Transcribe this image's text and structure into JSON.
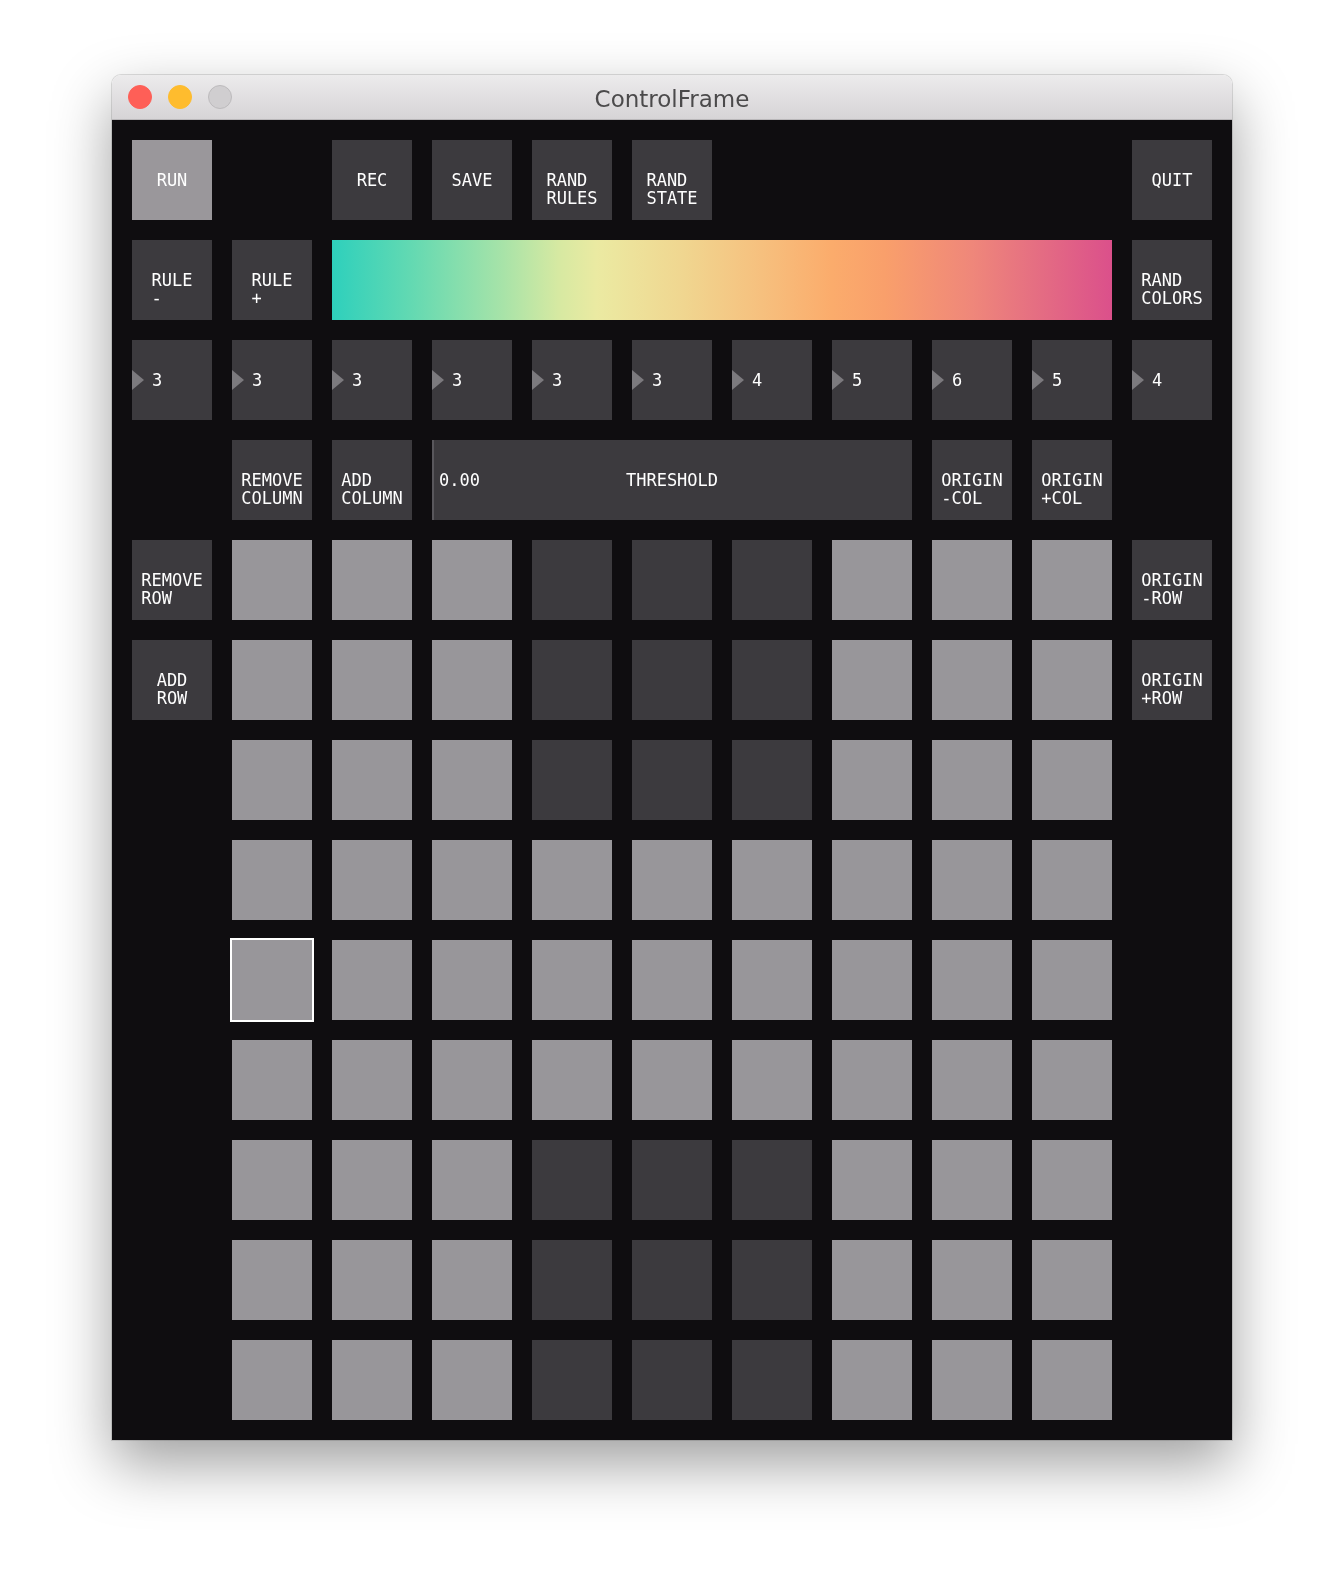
{
  "window": {
    "title": "ControlFrame",
    "buttons": [
      {
        "kind": "close",
        "disabled": false
      },
      {
        "kind": "minimize",
        "disabled": false
      },
      {
        "kind": "zoom",
        "disabled": true
      }
    ]
  },
  "run_toggle": {
    "label": "RUN",
    "on": true
  },
  "top_buttons": [
    {
      "label": "REC"
    },
    {
      "label": "SAVE"
    },
    {
      "label": "RAND\nRULES"
    },
    {
      "label": "RAND\nSTATE"
    }
  ],
  "quit_button": {
    "label": "QUIT"
  },
  "rule_buttons": [
    {
      "label": "RULE\n-"
    },
    {
      "label": "RULE\n+"
    }
  ],
  "rand_colors_button": {
    "label": "RAND\nCOLORS"
  },
  "number_boxes": [
    {
      "value": "3"
    },
    {
      "value": "3"
    },
    {
      "value": "3"
    },
    {
      "value": "3"
    },
    {
      "value": "3"
    },
    {
      "value": "3"
    },
    {
      "value": "4"
    },
    {
      "value": "5"
    },
    {
      "value": "6"
    },
    {
      "value": "5"
    },
    {
      "value": "4"
    }
  ],
  "column_buttons": [
    {
      "label": "REMOVE\nCOLUMN"
    },
    {
      "label": "ADD\nCOLUMN"
    }
  ],
  "threshold": {
    "label": "THRESHOLD",
    "value": "0.00",
    "level": 0
  },
  "origin_col_buttons": [
    {
      "label": "ORIGIN\n-COL"
    },
    {
      "label": "ORIGIN\n+COL"
    }
  ],
  "row_buttons": [
    {
      "label": "REMOVE\nROW"
    },
    {
      "label": "ADD\nROW"
    }
  ],
  "origin_row_buttons": [
    {
      "label": "ORIGIN\n-ROW"
    },
    {
      "label": "ORIGIN\n+ROW"
    }
  ],
  "cells": [
    [
      {
        "on": true,
        "selected": false
      },
      {
        "on": true,
        "selected": false
      },
      {
        "on": true,
        "selected": false
      },
      {
        "on": false,
        "selected": false
      },
      {
        "on": false,
        "selected": false
      },
      {
        "on": false,
        "selected": false
      },
      {
        "on": true,
        "selected": false
      },
      {
        "on": true,
        "selected": false
      },
      {
        "on": true,
        "selected": false
      }
    ],
    [
      {
        "on": true,
        "selected": false
      },
      {
        "on": true,
        "selected": false
      },
      {
        "on": true,
        "selected": false
      },
      {
        "on": false,
        "selected": false
      },
      {
        "on": false,
        "selected": false
      },
      {
        "on": false,
        "selected": false
      },
      {
        "on": true,
        "selected": false
      },
      {
        "on": true,
        "selected": false
      },
      {
        "on": true,
        "selected": false
      }
    ],
    [
      {
        "on": true,
        "selected": false
      },
      {
        "on": true,
        "selected": false
      },
      {
        "on": true,
        "selected": false
      },
      {
        "on": false,
        "selected": false
      },
      {
        "on": false,
        "selected": false
      },
      {
        "on": false,
        "selected": false
      },
      {
        "on": true,
        "selected": false
      },
      {
        "on": true,
        "selected": false
      },
      {
        "on": true,
        "selected": false
      }
    ],
    [
      {
        "on": true,
        "selected": false
      },
      {
        "on": true,
        "selected": false
      },
      {
        "on": true,
        "selected": false
      },
      {
        "on": true,
        "selected": false
      },
      {
        "on": true,
        "selected": false
      },
      {
        "on": true,
        "selected": false
      },
      {
        "on": true,
        "selected": false
      },
      {
        "on": true,
        "selected": false
      },
      {
        "on": true,
        "selected": false
      }
    ],
    [
      {
        "on": true,
        "selected": true
      },
      {
        "on": true,
        "selected": false
      },
      {
        "on": true,
        "selected": false
      },
      {
        "on": true,
        "selected": false
      },
      {
        "on": true,
        "selected": false
      },
      {
        "on": true,
        "selected": false
      },
      {
        "on": true,
        "selected": false
      },
      {
        "on": true,
        "selected": false
      },
      {
        "on": true,
        "selected": false
      }
    ],
    [
      {
        "on": true,
        "selected": false
      },
      {
        "on": true,
        "selected": false
      },
      {
        "on": true,
        "selected": false
      },
      {
        "on": true,
        "selected": false
      },
      {
        "on": true,
        "selected": false
      },
      {
        "on": true,
        "selected": false
      },
      {
        "on": true,
        "selected": false
      },
      {
        "on": true,
        "selected": false
      },
      {
        "on": true,
        "selected": false
      }
    ],
    [
      {
        "on": true,
        "selected": false
      },
      {
        "on": true,
        "selected": false
      },
      {
        "on": true,
        "selected": false
      },
      {
        "on": false,
        "selected": false
      },
      {
        "on": false,
        "selected": false
      },
      {
        "on": false,
        "selected": false
      },
      {
        "on": true,
        "selected": false
      },
      {
        "on": true,
        "selected": false
      },
      {
        "on": true,
        "selected": false
      }
    ],
    [
      {
        "on": true,
        "selected": false
      },
      {
        "on": true,
        "selected": false
      },
      {
        "on": true,
        "selected": false
      },
      {
        "on": false,
        "selected": false
      },
      {
        "on": false,
        "selected": false
      },
      {
        "on": false,
        "selected": false
      },
      {
        "on": true,
        "selected": false
      },
      {
        "on": true,
        "selected": false
      },
      {
        "on": true,
        "selected": false
      }
    ],
    [
      {
        "on": true,
        "selected": false
      },
      {
        "on": true,
        "selected": false
      },
      {
        "on": true,
        "selected": false
      },
      {
        "on": false,
        "selected": false
      },
      {
        "on": false,
        "selected": false
      },
      {
        "on": false,
        "selected": false
      },
      {
        "on": true,
        "selected": false
      },
      {
        "on": true,
        "selected": false
      },
      {
        "on": true,
        "selected": false
      }
    ]
  ]
}
